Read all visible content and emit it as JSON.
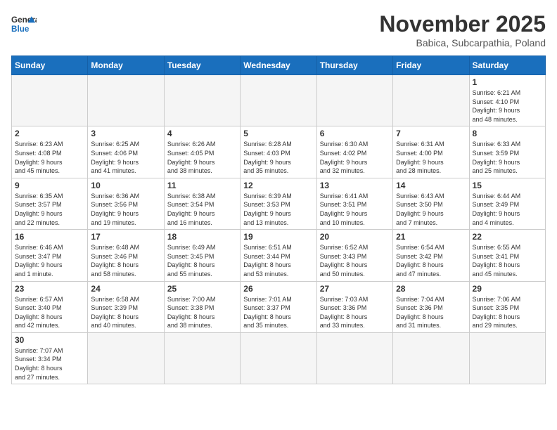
{
  "header": {
    "logo_general": "General",
    "logo_blue": "Blue",
    "month": "November 2025",
    "location": "Babica, Subcarpathia, Poland"
  },
  "weekdays": [
    "Sunday",
    "Monday",
    "Tuesday",
    "Wednesday",
    "Thursday",
    "Friday",
    "Saturday"
  ],
  "days": [
    {
      "num": "",
      "info": ""
    },
    {
      "num": "",
      "info": ""
    },
    {
      "num": "",
      "info": ""
    },
    {
      "num": "",
      "info": ""
    },
    {
      "num": "",
      "info": ""
    },
    {
      "num": "",
      "info": ""
    },
    {
      "num": "1",
      "info": "Sunrise: 6:21 AM\nSunset: 4:10 PM\nDaylight: 9 hours\nand 48 minutes."
    },
    {
      "num": "2",
      "info": "Sunrise: 6:23 AM\nSunset: 4:08 PM\nDaylight: 9 hours\nand 45 minutes."
    },
    {
      "num": "3",
      "info": "Sunrise: 6:25 AM\nSunset: 4:06 PM\nDaylight: 9 hours\nand 41 minutes."
    },
    {
      "num": "4",
      "info": "Sunrise: 6:26 AM\nSunset: 4:05 PM\nDaylight: 9 hours\nand 38 minutes."
    },
    {
      "num": "5",
      "info": "Sunrise: 6:28 AM\nSunset: 4:03 PM\nDaylight: 9 hours\nand 35 minutes."
    },
    {
      "num": "6",
      "info": "Sunrise: 6:30 AM\nSunset: 4:02 PM\nDaylight: 9 hours\nand 32 minutes."
    },
    {
      "num": "7",
      "info": "Sunrise: 6:31 AM\nSunset: 4:00 PM\nDaylight: 9 hours\nand 28 minutes."
    },
    {
      "num": "8",
      "info": "Sunrise: 6:33 AM\nSunset: 3:59 PM\nDaylight: 9 hours\nand 25 minutes."
    },
    {
      "num": "9",
      "info": "Sunrise: 6:35 AM\nSunset: 3:57 PM\nDaylight: 9 hours\nand 22 minutes."
    },
    {
      "num": "10",
      "info": "Sunrise: 6:36 AM\nSunset: 3:56 PM\nDaylight: 9 hours\nand 19 minutes."
    },
    {
      "num": "11",
      "info": "Sunrise: 6:38 AM\nSunset: 3:54 PM\nDaylight: 9 hours\nand 16 minutes."
    },
    {
      "num": "12",
      "info": "Sunrise: 6:39 AM\nSunset: 3:53 PM\nDaylight: 9 hours\nand 13 minutes."
    },
    {
      "num": "13",
      "info": "Sunrise: 6:41 AM\nSunset: 3:51 PM\nDaylight: 9 hours\nand 10 minutes."
    },
    {
      "num": "14",
      "info": "Sunrise: 6:43 AM\nSunset: 3:50 PM\nDaylight: 9 hours\nand 7 minutes."
    },
    {
      "num": "15",
      "info": "Sunrise: 6:44 AM\nSunset: 3:49 PM\nDaylight: 9 hours\nand 4 minutes."
    },
    {
      "num": "16",
      "info": "Sunrise: 6:46 AM\nSunset: 3:47 PM\nDaylight: 9 hours\nand 1 minute."
    },
    {
      "num": "17",
      "info": "Sunrise: 6:48 AM\nSunset: 3:46 PM\nDaylight: 8 hours\nand 58 minutes."
    },
    {
      "num": "18",
      "info": "Sunrise: 6:49 AM\nSunset: 3:45 PM\nDaylight: 8 hours\nand 55 minutes."
    },
    {
      "num": "19",
      "info": "Sunrise: 6:51 AM\nSunset: 3:44 PM\nDaylight: 8 hours\nand 53 minutes."
    },
    {
      "num": "20",
      "info": "Sunrise: 6:52 AM\nSunset: 3:43 PM\nDaylight: 8 hours\nand 50 minutes."
    },
    {
      "num": "21",
      "info": "Sunrise: 6:54 AM\nSunset: 3:42 PM\nDaylight: 8 hours\nand 47 minutes."
    },
    {
      "num": "22",
      "info": "Sunrise: 6:55 AM\nSunset: 3:41 PM\nDaylight: 8 hours\nand 45 minutes."
    },
    {
      "num": "23",
      "info": "Sunrise: 6:57 AM\nSunset: 3:40 PM\nDaylight: 8 hours\nand 42 minutes."
    },
    {
      "num": "24",
      "info": "Sunrise: 6:58 AM\nSunset: 3:39 PM\nDaylight: 8 hours\nand 40 minutes."
    },
    {
      "num": "25",
      "info": "Sunrise: 7:00 AM\nSunset: 3:38 PM\nDaylight: 8 hours\nand 38 minutes."
    },
    {
      "num": "26",
      "info": "Sunrise: 7:01 AM\nSunset: 3:37 PM\nDaylight: 8 hours\nand 35 minutes."
    },
    {
      "num": "27",
      "info": "Sunrise: 7:03 AM\nSunset: 3:36 PM\nDaylight: 8 hours\nand 33 minutes."
    },
    {
      "num": "28",
      "info": "Sunrise: 7:04 AM\nSunset: 3:36 PM\nDaylight: 8 hours\nand 31 minutes."
    },
    {
      "num": "29",
      "info": "Sunrise: 7:06 AM\nSunset: 3:35 PM\nDaylight: 8 hours\nand 29 minutes."
    },
    {
      "num": "30",
      "info": "Sunrise: 7:07 AM\nSunset: 3:34 PM\nDaylight: 8 hours\nand 27 minutes."
    },
    {
      "num": "",
      "info": ""
    },
    {
      "num": "",
      "info": ""
    },
    {
      "num": "",
      "info": ""
    },
    {
      "num": "",
      "info": ""
    },
    {
      "num": "",
      "info": ""
    },
    {
      "num": "",
      "info": ""
    }
  ]
}
